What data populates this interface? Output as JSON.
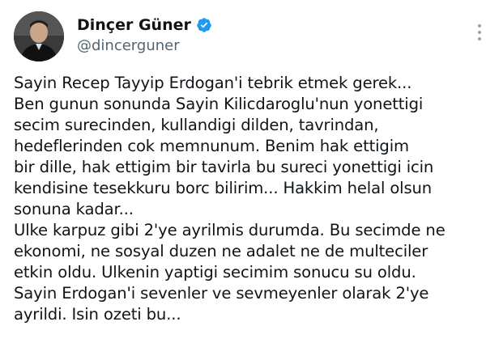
{
  "author": {
    "display_name": "Dinçer Güner",
    "handle": "@dincerguner",
    "verified": true,
    "verified_color": "#1d9bf0"
  },
  "menu": {
    "icon": "more-vertical-icon"
  },
  "tweet": {
    "lines": [
      "Sayin Recep Tayyip Erdogan'i tebrik etmek gerek...",
      "Ben gunun sonunda Sayin Kilicdaroglu'nun yonettigi",
      "secim surecinden, kullandigi dilden, tavrindan,",
      "hedeflerinden cok memnunum. Benim hak ettigim",
      "bir dille, hak ettigim bir tavirla bu sureci yonettigi icin",
      "kendisine tesekkuru borc bilirim... Hakkim helal olsun",
      "sonuna kadar...",
      "Ulke karpuz gibi 2'ye ayrilmis durumda. Bu secimde ne",
      "ekonomi, ne sosyal duzen ne adalet ne de multeciler",
      "etkin oldu. Ulkenin yaptigi secimim sonucu su oldu.",
      "Sayin Erdogan'i sevenler ve sevmeyenler olarak 2'ye",
      "ayrildi. Isin ozeti bu..."
    ]
  }
}
